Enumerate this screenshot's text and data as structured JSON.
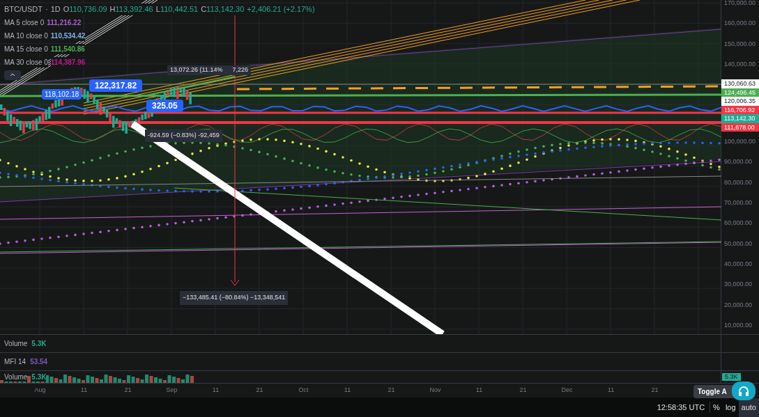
{
  "symbol": {
    "pair": "BTC/USDT",
    "separator": "·",
    "interval": "1D",
    "ohlc": [
      {
        "label": "O",
        "value": "110,736.09"
      },
      {
        "label": "H",
        "value": "113,392.46"
      },
      {
        "label": "L",
        "value": "110,442.51"
      },
      {
        "label": "C",
        "value": "113,142.30"
      }
    ],
    "change": "+2,406.21 (+2.17%)"
  },
  "indicators": [
    {
      "name": "MA 5 close 0",
      "value": "111,216.22",
      "color": "#a65fd0"
    },
    {
      "name": "MA 10 close 0",
      "value": "110,534.42",
      "color": "#7fb0e8"
    },
    {
      "name": "MA 15 close 0",
      "value": "111,540.86",
      "color": "#4caf50"
    },
    {
      "name": "MA 30 close 0",
      "value": "114,387.96",
      "color": "#c2188f"
    }
  ],
  "price_axis_upper": [
    "170,000.00",
    "160,000.00",
    "150,000.00",
    "140,000.00"
  ],
  "price_axis_lower": [
    "100,000.00",
    "90,000.00",
    "80,000.00",
    "70,000.00",
    "60,000.00",
    "50,000.00",
    "40,000.00",
    "30,000.00",
    "20,000.00",
    "10,000.00"
  ],
  "price_badges": [
    {
      "text": "130,060.63",
      "color": "#ffffff"
    },
    {
      "text": "124,496.45",
      "color": "#4caf50"
    },
    {
      "text": "120,006.35",
      "color": "#ffffff"
    },
    {
      "text": "116,706.92",
      "color": "#f23645"
    },
    {
      "text": "113,142.30",
      "color": "#22ab94"
    },
    {
      "text": "111,678.00",
      "color": "#f23645"
    }
  ],
  "chart_labels": [
    {
      "text": "118,102.18"
    },
    {
      "text": "122,317.82"
    },
    {
      "text": "325.05"
    }
  ],
  "measure_tooltips": [
    {
      "text": "13,072.26 (11.14%"
    },
    {
      "text": "7,226"
    },
    {
      "text": "-924.59 (−0.83%) -92,459"
    },
    {
      "text": "−133,485.41 (−80.84%) −13,348,541"
    }
  ],
  "panes": [
    {
      "name": "Volume",
      "value": "5.3K",
      "color": "#22ab94"
    },
    {
      "name": "MFI 14",
      "value": "53.54",
      "color": "#7e57c2"
    },
    {
      "name": "Volume",
      "value": "5.3K",
      "color": "#22ab94"
    }
  ],
  "volume_badge": "5.3K",
  "time_axis": [
    "Aug",
    "11",
    "21",
    "Sep",
    "11",
    "21",
    "Oct",
    "11",
    "21",
    "Nov",
    "11",
    "21",
    "Dec",
    "11",
    "21"
  ],
  "tooltip": "Toggle A",
  "status_bar": {
    "time": "12:58:35 UTC",
    "buttons": [
      {
        "label": "%",
        "selected": false
      },
      {
        "label": "log",
        "selected": false
      },
      {
        "label": "auto",
        "selected": true
      }
    ]
  }
}
